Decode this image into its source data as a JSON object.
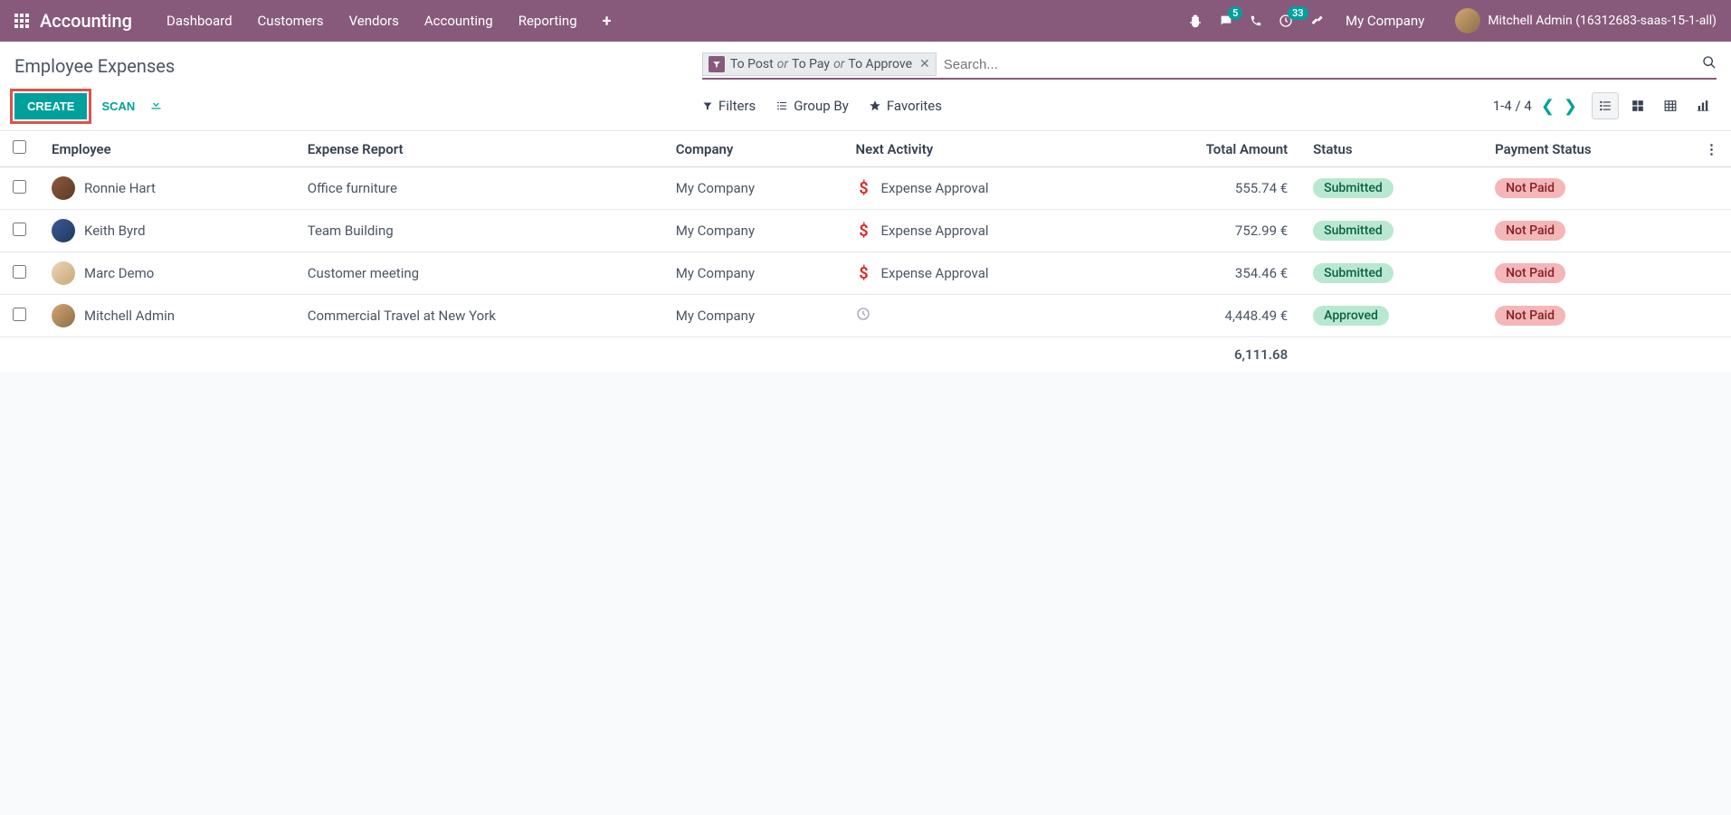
{
  "navbar": {
    "brand": "Accounting",
    "links": [
      "Dashboard",
      "Customers",
      "Vendors",
      "Accounting",
      "Reporting"
    ],
    "chat_badge": "5",
    "activity_badge": "33",
    "company": "My Company",
    "user": "Mitchell Admin (16312683-saas-15-1-all)"
  },
  "page": {
    "title": "Employee Expenses",
    "create": "CREATE",
    "scan": "SCAN",
    "search_placeholder": "Search...",
    "filter_chip": {
      "p1": "To Post",
      "p2": "To Pay",
      "p3": "To Approve",
      "or": "or"
    },
    "tools": {
      "filters": "Filters",
      "groupby": "Group By",
      "favorites": "Favorites"
    },
    "pager": "1-4 / 4"
  },
  "table": {
    "headers": {
      "employee": "Employee",
      "report": "Expense Report",
      "company": "Company",
      "activity": "Next Activity",
      "amount": "Total Amount",
      "status": "Status",
      "payment": "Payment Status"
    },
    "rows": [
      {
        "employee": "Ronnie Hart",
        "report": "Office furniture",
        "company": "My Company",
        "activity": "Expense Approval",
        "activity_type": "dollar",
        "amount": "555.74 €",
        "status": "Submitted",
        "payment": "Not Paid"
      },
      {
        "employee": "Keith Byrd",
        "report": "Team Building",
        "company": "My Company",
        "activity": "Expense Approval",
        "activity_type": "dollar",
        "amount": "752.99 €",
        "status": "Submitted",
        "payment": "Not Paid"
      },
      {
        "employee": "Marc Demo",
        "report": "Customer meeting",
        "company": "My Company",
        "activity": "Expense Approval",
        "activity_type": "dollar",
        "amount": "354.46 €",
        "status": "Submitted",
        "payment": "Not Paid"
      },
      {
        "employee": "Mitchell Admin",
        "report": "Commercial Travel at New York",
        "company": "My Company",
        "activity": "",
        "activity_type": "clock",
        "amount": "4,448.49 €",
        "status": "Approved",
        "payment": "Not Paid"
      }
    ],
    "total": "6,111.68"
  }
}
